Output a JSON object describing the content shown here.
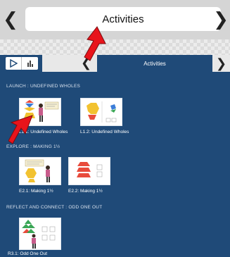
{
  "header": {
    "title": "Activities",
    "back_glyph": "❮",
    "forward_glyph": "❯"
  },
  "subbar": {
    "title": "Activities",
    "left_glyph": "❮",
    "right_glyph": "❯"
  },
  "sections": [
    {
      "label": "LAUNCH : UNDEFINED WHOLES",
      "cards": [
        {
          "label": "L1.1: Undefined Wholes"
        },
        {
          "label": "L1.2: Undefined Wholes"
        }
      ]
    },
    {
      "label": "EXPLORE : MAKING 1½",
      "cards": [
        {
          "label": "E2.1: Making 1½"
        },
        {
          "label": "E2.2: Making 1½"
        }
      ]
    },
    {
      "label": "REFLECT AND CONNECT : ODD ONE OUT",
      "cards": [
        {
          "label": "R3.1: Odd One Out"
        }
      ]
    }
  ],
  "colors": {
    "panel": "#1f4a78",
    "arrow": "#e8141b"
  }
}
